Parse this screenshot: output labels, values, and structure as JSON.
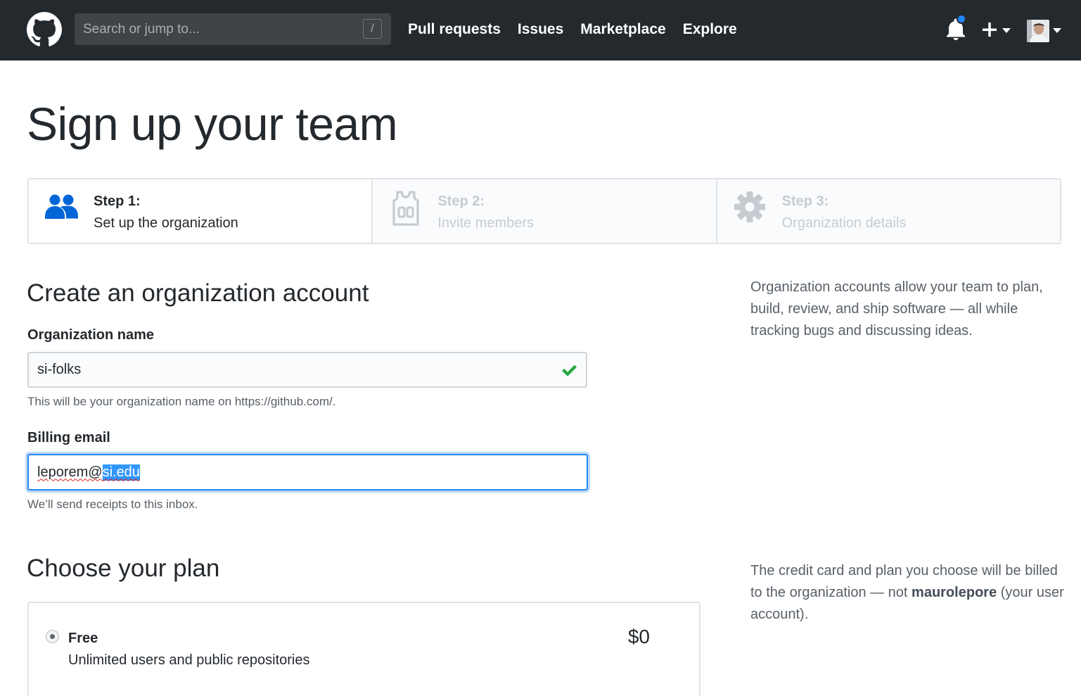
{
  "header": {
    "search_placeholder": "Search or jump to...",
    "search_shortcut": "/",
    "nav": [
      "Pull requests",
      "Issues",
      "Marketplace",
      "Explore"
    ],
    "icons": [
      "github-logo-icon",
      "bell-icon",
      "plus-icon",
      "avatar"
    ],
    "notification_dot_color": "#2188ff"
  },
  "page_title": "Sign up your team",
  "steps": [
    {
      "title": "Step 1:",
      "subtitle": "Set up the organization",
      "icon": "people-icon",
      "state": "active"
    },
    {
      "title": "Step 2:",
      "subtitle": "Invite members",
      "icon": "jersey-icon",
      "state": "inactive"
    },
    {
      "title": "Step 3:",
      "subtitle": "Organization details",
      "icon": "gear-icon",
      "state": "inactive"
    }
  ],
  "form": {
    "heading": "Create an organization account",
    "org_name_label": "Organization name",
    "org_name_value": "si-folks",
    "org_name_note": "This will be your organization name on https://github.com/.",
    "email_label": "Billing email",
    "email_value_unselected": "leporem@",
    "email_value_selected": "si.edu",
    "email_note": "We’ll send receipts to this inbox."
  },
  "aside_org": "Organization accounts allow your team to plan, build, review, and ship software — all while tracking bugs and discussing ideas.",
  "plan": {
    "heading": "Choose your plan",
    "aside_prefix": "The credit card and plan you choose will be billed to the organization — not ",
    "aside_user": "maurolepore",
    "aside_suffix": " (your user account).",
    "options": [
      {
        "name": "Free",
        "description": "Unlimited users and public repositories",
        "price": "$0",
        "selected": true
      }
    ]
  },
  "colors": {
    "header_bg": "#24292e",
    "active_step_icon": "#0366d6",
    "check_green": "#28a745",
    "focus_blue": "#2188ff",
    "selection_blue": "#3297fd"
  }
}
